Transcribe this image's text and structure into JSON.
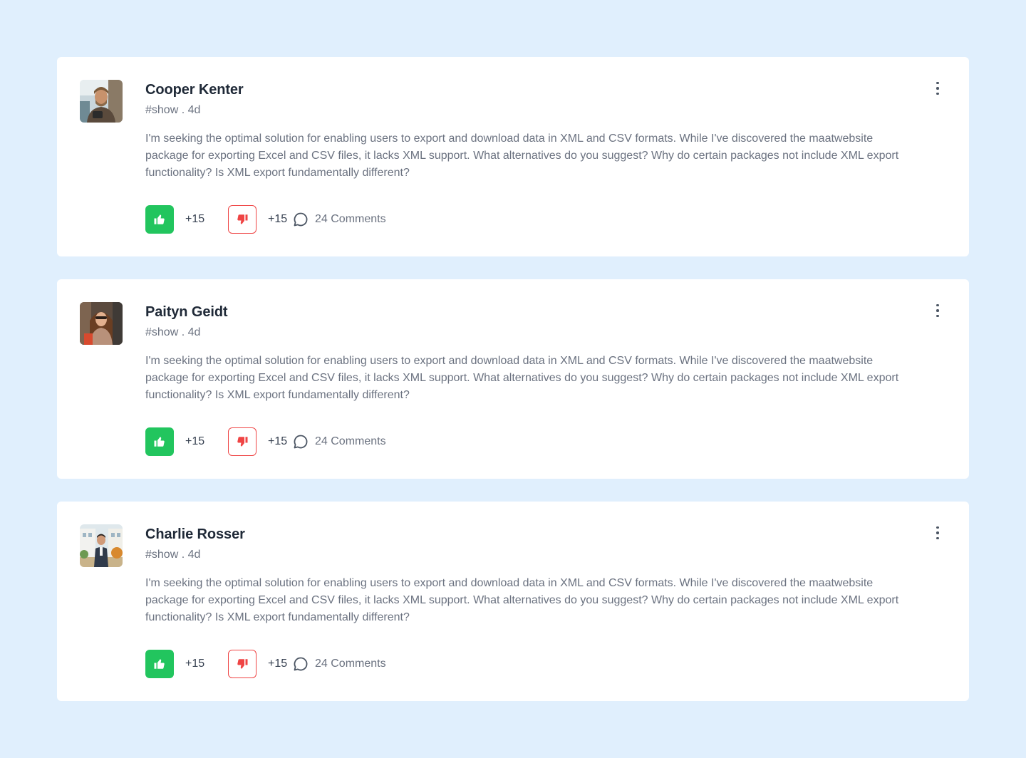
{
  "colors": {
    "background": "#e0effd",
    "like": "#22c55e",
    "dislike": "#ef4444"
  },
  "posts": [
    {
      "author": "Cooper Kenter",
      "meta": "#show . 4d",
      "body": "I'm seeking the optimal solution for enabling users to export and download data in XML and CSV formats. While I've discovered the maatwebsite package for exporting Excel and CSV files, it lacks XML support. What alternatives do you suggest? Why do certain packages not include XML export functionality? Is XML export fundamentally different?",
      "likes": "+15",
      "dislikes": "+15",
      "comments": "24 Comments"
    },
    {
      "author": "Paityn Geidt",
      "meta": "#show . 4d",
      "body": "I'm seeking the optimal solution for enabling users to export and download data in XML and CSV formats. While I've discovered the maatwebsite package for exporting Excel and CSV files, it lacks XML support. What alternatives do you suggest? Why do certain packages not include XML export functionality? Is XML export fundamentally different?",
      "likes": "+15",
      "dislikes": "+15",
      "comments": "24 Comments"
    },
    {
      "author": "Charlie Rosser",
      "meta": "#show . 4d",
      "body": "I'm seeking the optimal solution for enabling users to export and download data in XML and CSV formats. While I've discovered the maatwebsite package for exporting Excel and CSV files, it lacks XML support. What alternatives do you suggest? Why do certain packages not include XML export functionality? Is XML export fundamentally different?",
      "likes": "+15",
      "dislikes": "+15",
      "comments": "24 Comments"
    }
  ]
}
